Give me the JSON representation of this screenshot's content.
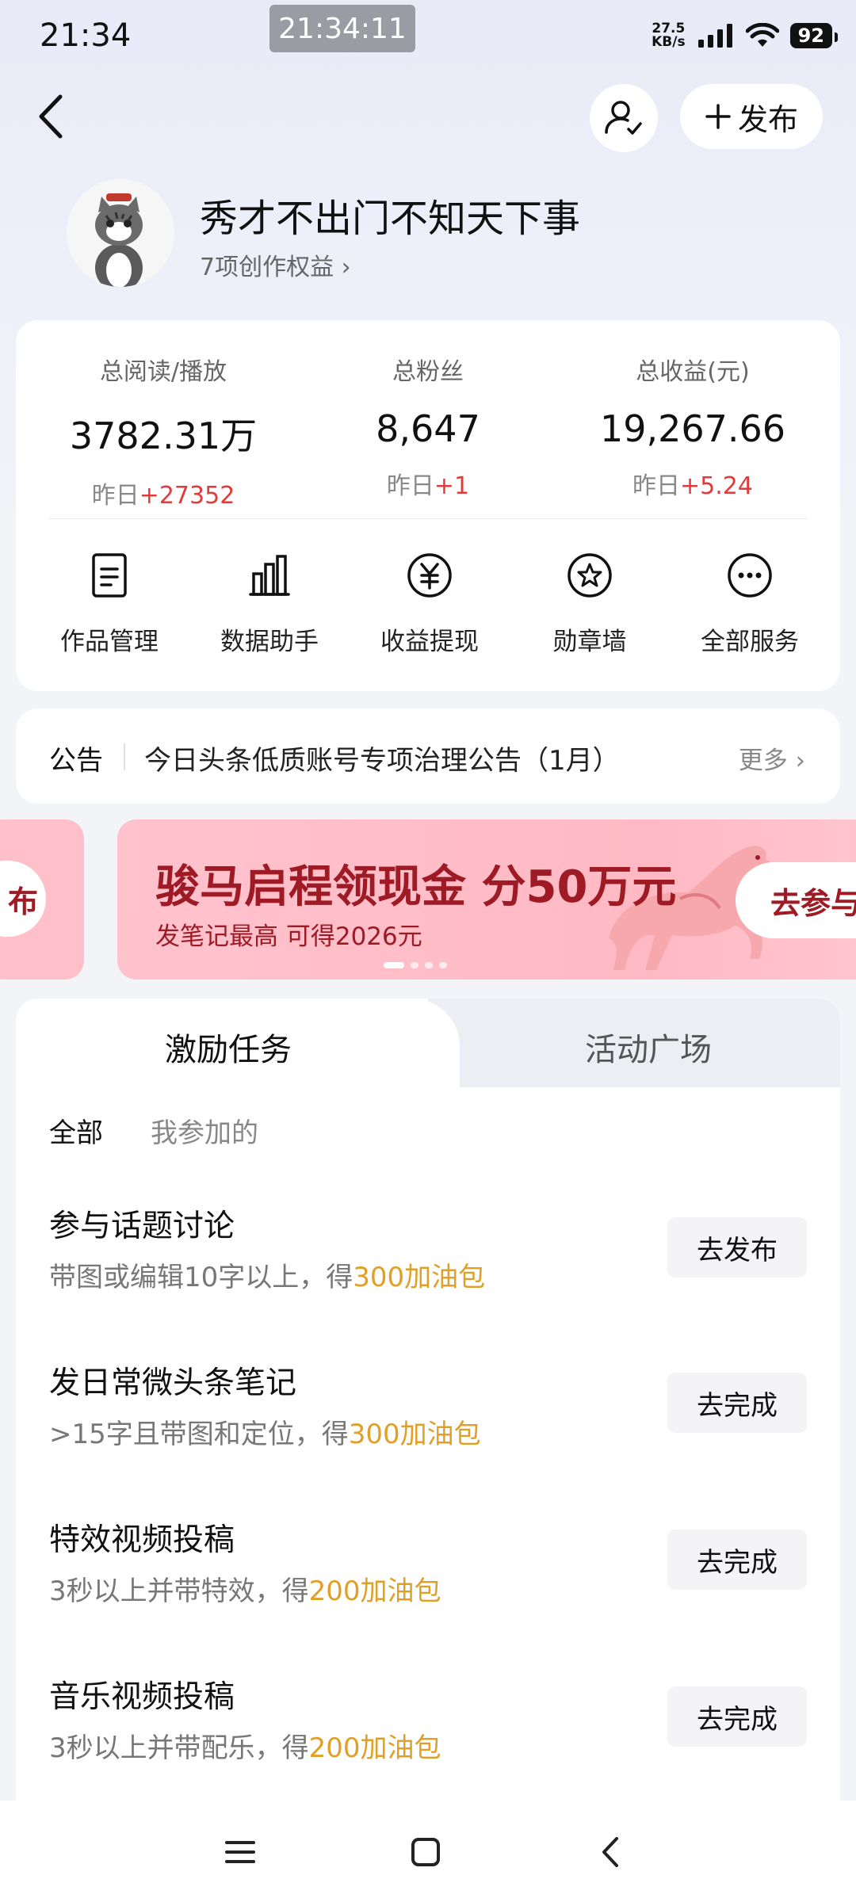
{
  "status_bar": {
    "time": "21:34",
    "center_time": "21:34:11",
    "net_speed_value": "27.5",
    "net_speed_unit": "KB/s",
    "battery": "92"
  },
  "header": {
    "publish_label": "发布"
  },
  "profile": {
    "name": "秀才不出门不知天下事",
    "perks": "7项创作权益"
  },
  "stats": [
    {
      "label": "总阅读/播放",
      "value": "3782.31万",
      "delta_prefix": "昨日",
      "delta": "+27352"
    },
    {
      "label": "总粉丝",
      "value": "8,647",
      "delta_prefix": "昨日",
      "delta": "+1"
    },
    {
      "label": "总收益(元)",
      "value": "19,267.66",
      "delta_prefix": "昨日",
      "delta": "+5.24"
    }
  ],
  "services": [
    {
      "label": "作品管理",
      "icon": "document-icon"
    },
    {
      "label": "数据助手",
      "icon": "bar-chart-icon"
    },
    {
      "label": "收益提现",
      "icon": "yuan-coin-icon"
    },
    {
      "label": "勋章墙",
      "icon": "medal-star-icon"
    },
    {
      "label": "全部服务",
      "icon": "more-dots-icon"
    }
  ],
  "notice": {
    "tag": "公告",
    "text": "今日头条低质账号专项治理公告（1月）",
    "more": "更多"
  },
  "banner": {
    "prev_cta_fragment": "布",
    "title": "骏马启程领现金 分50万元",
    "subtitle": "发笔记最高 可得2026元",
    "cta": "去参与",
    "dot_count": 4,
    "active_dot": 0
  },
  "tabs": {
    "active": "激励任务",
    "inactive": "活动广场"
  },
  "filters": {
    "all": "全部",
    "joined": "我参加的"
  },
  "tasks": [
    {
      "title": "参与话题讨论",
      "desc": "带图或编辑10字以上，得",
      "reward": "300加油包",
      "button": "去发布"
    },
    {
      "title": "发日常微头条笔记",
      "desc": ">15字且带图和定位，得",
      "reward": "300加油包",
      "button": "去完成"
    },
    {
      "title": "特效视频投稿",
      "desc": "3秒以上并带特效，得",
      "reward": "200加油包",
      "button": "去完成"
    },
    {
      "title": "音乐视频投稿",
      "desc": "3秒以上并带配乐，得",
      "reward": "200加油包",
      "button": "去完成"
    }
  ],
  "colors": {
    "accent_red": "#e23b3b",
    "reward_orange": "#e0a028",
    "banner_text": "#9e1a25",
    "banner_bg": "#ffbfc9"
  }
}
